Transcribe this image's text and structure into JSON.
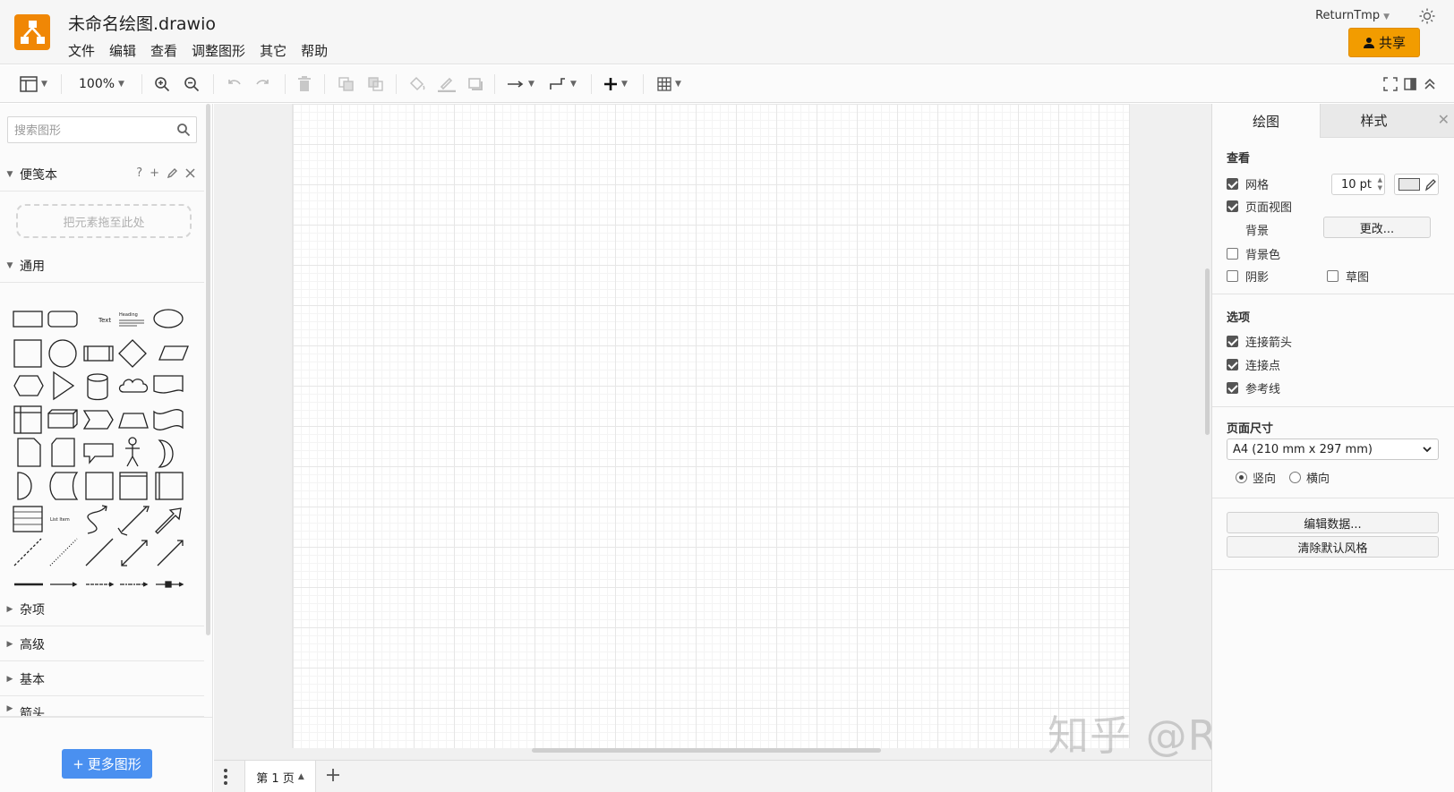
{
  "header": {
    "title": "未命名绘图.drawio",
    "menu": [
      "文件",
      "编辑",
      "查看",
      "调整图形",
      "其它",
      "帮助"
    ],
    "user": "ReturnTmp",
    "share_label": "共享"
  },
  "toolbar": {
    "zoom": "100%"
  },
  "sidebar": {
    "search_placeholder": "搜索图形",
    "scratchpad_title": "便笺本",
    "scratchpad_tools": [
      "?",
      "+"
    ],
    "drop_hint": "把元素拖至此处",
    "general_title": "通用",
    "shape_text_label": "Text",
    "shape_heading_label": "Heading",
    "shape_listitem_label": "List Item",
    "collapsed_sections": [
      "杂项",
      "高级",
      "基本",
      "箭头"
    ],
    "more_shapes_label": "更多图形"
  },
  "pages": {
    "current": "第 1 页"
  },
  "watermark": "知乎 @ReturnTmp",
  "format_panel": {
    "tabs": [
      "绘图",
      "样式"
    ],
    "view_heading": "查看",
    "grid_label": "网格",
    "grid_size": "10 pt",
    "page_view_label": "页面视图",
    "background_label": "背景",
    "change_label": "更改...",
    "background_color_label": "背景色",
    "shadow_label": "阴影",
    "sketch_label": "草图",
    "options_heading": "选项",
    "connection_arrows_label": "连接箭头",
    "connection_points_label": "连接点",
    "guides_label": "参考线",
    "page_size_heading": "页面尺寸",
    "page_size_value": "A4 (210 mm x 297 mm)",
    "portrait_label": "竖向",
    "landscape_label": "横向",
    "edit_data_label": "编辑数据...",
    "clear_style_label": "清除默认风格"
  },
  "colors": {
    "accent": "#f29c00",
    "logo": "#f08705",
    "more_button": "#4a90f0"
  }
}
